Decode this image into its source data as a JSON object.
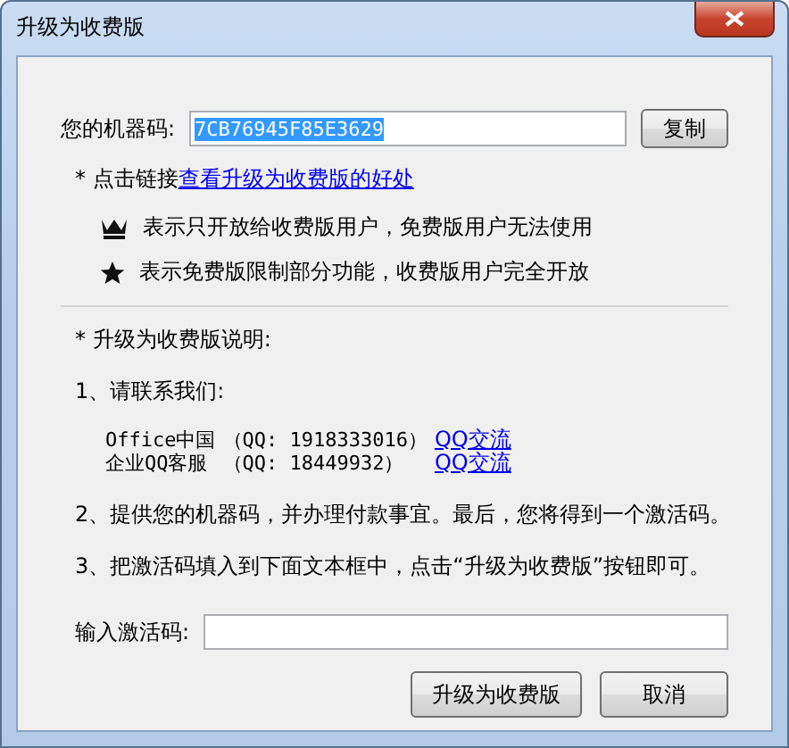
{
  "window": {
    "title": "升级为收费版"
  },
  "machine_code": {
    "label": "您的机器码:",
    "value": "7CB76945F85E3629",
    "selected": true,
    "copy_button": "复制"
  },
  "benefits": {
    "prefix": "* 点击链接",
    "link": "查看升级为收费版的好处"
  },
  "legend": [
    {
      "kind": "crown",
      "text": "表示只开放给收费版用户，免费版用户无法使用"
    },
    {
      "kind": "star",
      "text": "表示免费版限制部分功能，收费版用户完全开放"
    }
  ],
  "instructions": {
    "heading": "* 升级为收费版说明:",
    "step_1": "1、请联系我们:",
    "contacts": [
      {
        "name": "Office中国",
        "qq": "（QQ: 1918333016）",
        "link": "QQ交流"
      },
      {
        "name": "企业QQ客服",
        "qq": "（QQ: 18449932）",
        "link": "QQ交流"
      }
    ],
    "step_2": "2、提供您的机器码，并办理付款事宜。最后，您将得到一个激活码。",
    "step_3": "3、把激活码填入到下面文本框中，点击“升级为收费版”按钮即可。"
  },
  "activation": {
    "label": "输入激活码:"
  },
  "buttons": [
    "升级为收费版",
    "取消"
  ]
}
